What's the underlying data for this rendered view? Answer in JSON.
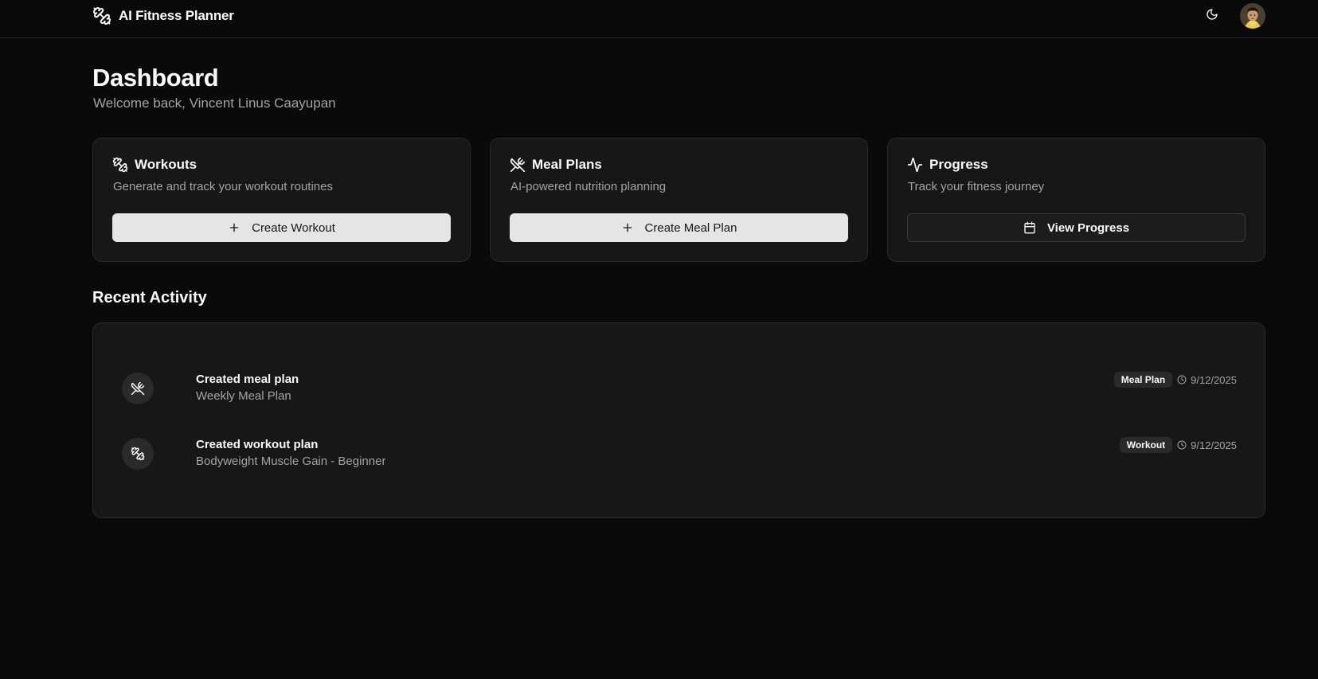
{
  "header": {
    "brand_title": "AI Fitness Planner",
    "brand_icon": "dumbbell-icon",
    "theme_toggle_icon": "moon-icon",
    "avatar": "user-avatar"
  },
  "page": {
    "title": "Dashboard",
    "subtitle": "Welcome back, Vincent Linus Caayupan"
  },
  "cards": [
    {
      "icon": "dumbbell-icon",
      "title": "Workouts",
      "description": "Generate and track your workout routines",
      "button_label": "Create Workout",
      "button_icon": "plus-icon",
      "button_style": "primary"
    },
    {
      "icon": "utensils-crossed-icon",
      "title": "Meal Plans",
      "description": "AI-powered nutrition planning",
      "button_label": "Create Meal Plan",
      "button_icon": "plus-icon",
      "button_style": "primary"
    },
    {
      "icon": "activity-icon",
      "title": "Progress",
      "description": "Track your fitness journey",
      "button_label": "View Progress",
      "button_icon": "calendar-icon",
      "button_style": "outline"
    }
  ],
  "recent_activity": {
    "title": "Recent Activity",
    "items": [
      {
        "icon": "utensils-crossed-icon",
        "title": "Created meal plan",
        "detail": "Weekly Meal Plan",
        "badge": "Meal Plan",
        "date": "9/12/2025"
      },
      {
        "icon": "dumbbell-icon",
        "title": "Created workout plan",
        "detail": "Bodyweight Muscle Gain - Beginner",
        "badge": "Workout",
        "date": "9/12/2025"
      }
    ]
  },
  "colors": {
    "background": "#0a0a0a",
    "card": "#171717",
    "border": "#2a2a2a",
    "muted_text": "#a3a3a3",
    "primary_button": "#e5e5e5"
  }
}
